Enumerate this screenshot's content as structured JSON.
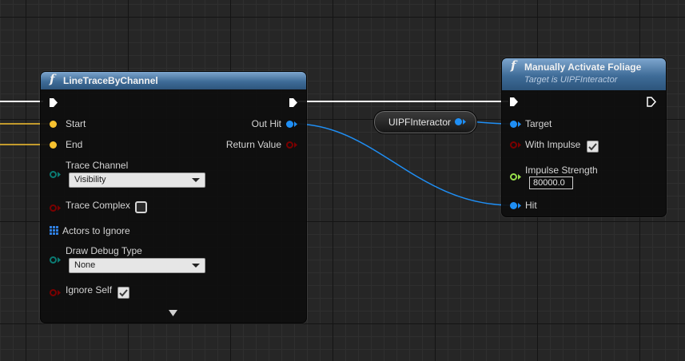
{
  "colors": {
    "exec": "#ffffff",
    "float_pin": "#f6c12f",
    "object_pin": "#1f8ff5",
    "bool_pin": "#7a0000",
    "byte_pin": "#0b7b73",
    "number_pin": "#97df4a",
    "header": "#3f6c98"
  },
  "trace_node": {
    "icon": "function-icon",
    "title": "LineTraceByChannel",
    "inputs": {
      "start": "Start",
      "end": "End",
      "trace_channel": "Trace Channel",
      "trace_channel_value": "Visibility",
      "trace_complex": "Trace Complex",
      "actors_to_ignore": "Actors to Ignore",
      "draw_debug_type": "Draw Debug Type",
      "draw_debug_value": "None",
      "ignore_self": "Ignore Self"
    },
    "outputs": {
      "out_hit": "Out Hit",
      "return_value": "Return Value"
    },
    "trace_complex_checked": false,
    "ignore_self_checked": true
  },
  "var_node": {
    "label": "UIPFInteractor"
  },
  "foliage_node": {
    "icon": "function-icon",
    "title": "Manually Activate Foliage",
    "subtitle": "Target is UIPFInteractor",
    "inputs": {
      "target": "Target",
      "with_impulse": "With Impulse",
      "impulse_strength": "Impulse Strength",
      "impulse_strength_value": "80000.0",
      "hit": "Hit"
    },
    "with_impulse_checked": true
  }
}
